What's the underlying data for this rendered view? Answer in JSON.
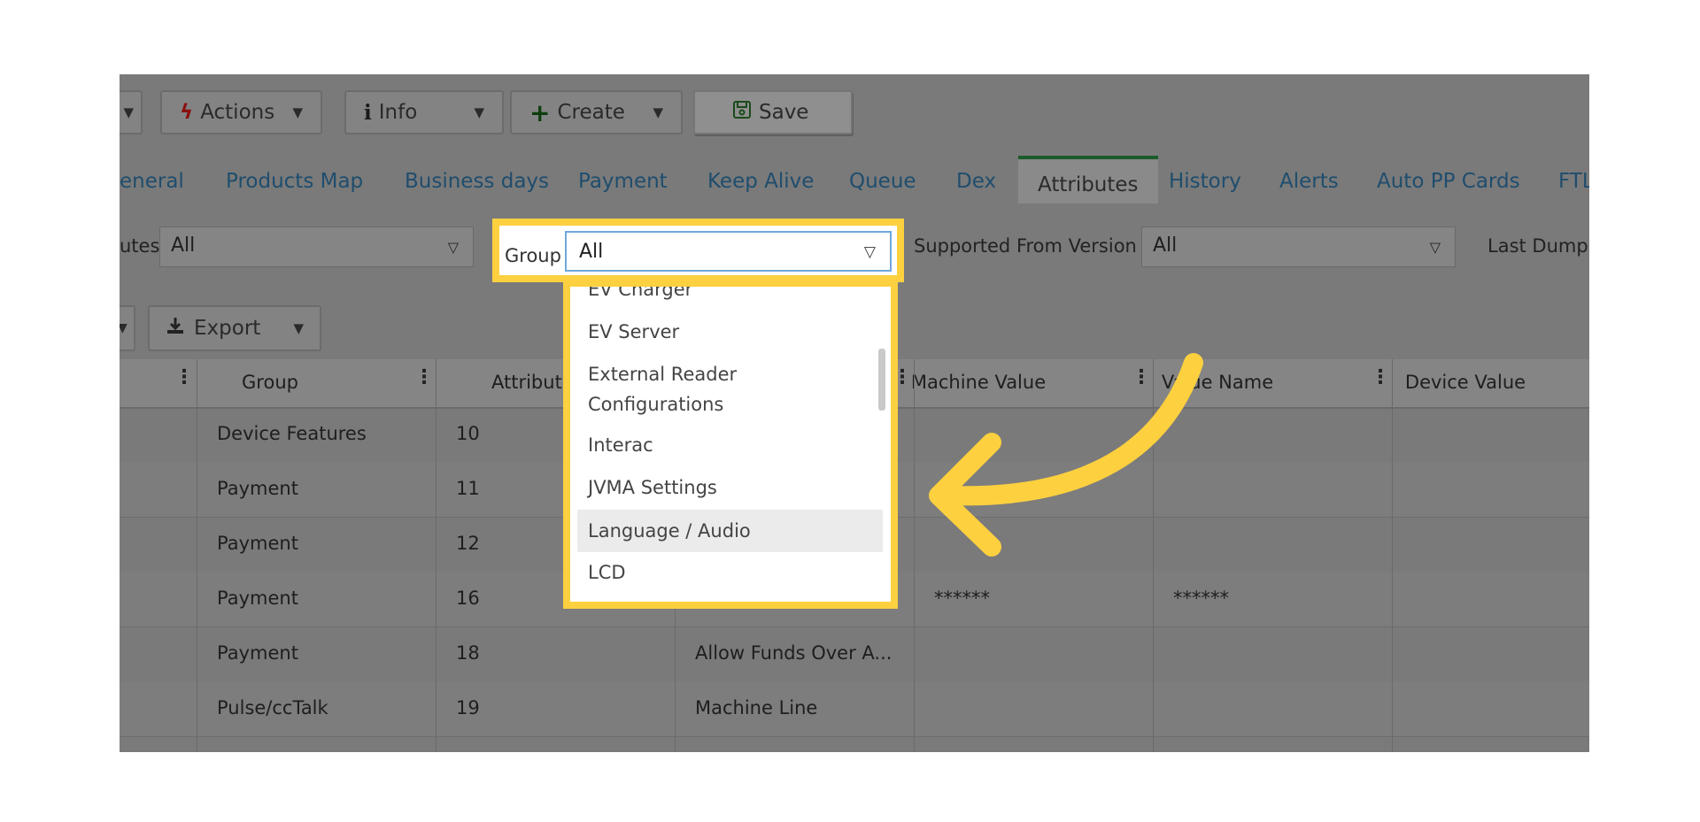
{
  "toolbar": {
    "actions_label": "Actions",
    "info_label": "Info",
    "create_label": "Create",
    "save_label": "Save"
  },
  "tabs": [
    {
      "label": "eneral"
    },
    {
      "label": "Products Map"
    },
    {
      "label": "Business days"
    },
    {
      "label": "Payment"
    },
    {
      "label": "Keep Alive"
    },
    {
      "label": "Queue"
    },
    {
      "label": "Dex"
    },
    {
      "label": "Attributes",
      "active": true
    },
    {
      "label": "History"
    },
    {
      "label": "Alerts"
    },
    {
      "label": "Auto PP Cards"
    },
    {
      "label": "FTL"
    }
  ],
  "filters": {
    "attributes_label": "utes",
    "attributes_value": "All",
    "group_label": "Group",
    "group_value": "All",
    "version_label": "Supported From Version",
    "version_value": "All",
    "last_dump_label": "Last Dump:"
  },
  "export_label": "Export",
  "dropdown": {
    "items": [
      {
        "label": "EV Charger"
      },
      {
        "label": "EV Server"
      },
      {
        "label": "External Reader\nConfigurations"
      },
      {
        "label": "Interac"
      },
      {
        "label": "JVMA Settings"
      },
      {
        "label": "Language / Audio",
        "hovered": true
      },
      {
        "label": "LCD"
      }
    ]
  },
  "table": {
    "columns": [
      "Group",
      "Attribut",
      "Machine Value",
      "Value Name",
      "Device Value"
    ],
    "rows": [
      {
        "group": "Device Features",
        "attr": "10",
        "name": "",
        "machine": "",
        "value_name": ""
      },
      {
        "group": "Payment",
        "attr": "11",
        "name": "",
        "machine": "",
        "value_name": ""
      },
      {
        "group": "Payment",
        "attr": "12",
        "name": "",
        "machine": "",
        "value_name": ""
      },
      {
        "group": "Payment",
        "attr": "16",
        "name": "",
        "machine": "******",
        "value_name": "******"
      },
      {
        "group": "Payment",
        "attr": "18",
        "name": "Allow Funds Over A...",
        "machine": "",
        "value_name": ""
      },
      {
        "group": "Pulse/ccTalk",
        "attr": "19",
        "name": "Machine Line",
        "machine": "",
        "value_name": ""
      }
    ]
  },
  "colors": {
    "highlight": "#fdd03f",
    "overlay": "#7a7a7a"
  }
}
